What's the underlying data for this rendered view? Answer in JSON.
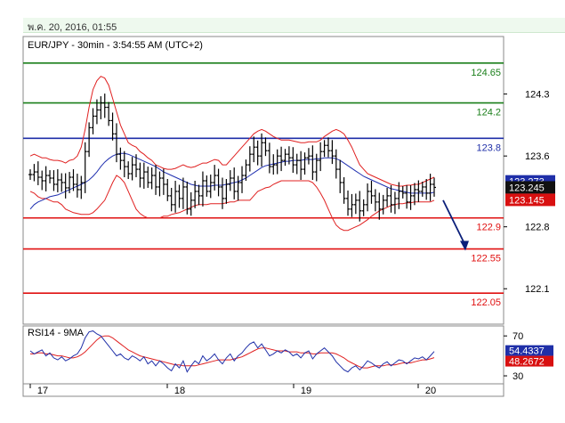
{
  "header": {
    "date_text": "พ.ค. 20, 2016, 01:55"
  },
  "chart_data": {
    "type": "candlestick",
    "title": "EUR/JPY - 30min - 3:54:55 AM (UTC+2)",
    "ylim": [
      121.7,
      124.95
    ],
    "y_ticks": [
      "124.3",
      "123.6",
      "122.8",
      "122.1"
    ],
    "x_ticks": [
      "17",
      "18",
      "19",
      "20"
    ],
    "levels": [
      {
        "value": 124.65,
        "label": "124.65",
        "color": "#1a7f1a"
      },
      {
        "value": 124.2,
        "label": "124.2",
        "color": "#1a7f1a"
      },
      {
        "value": 123.8,
        "label": "123.8",
        "color": "#1f2fa8"
      },
      {
        "value": 122.9,
        "label": "122.9",
        "color": "#e01010"
      },
      {
        "value": 122.55,
        "label": "122.55",
        "color": "#e01010"
      },
      {
        "value": 122.05,
        "label": "122.05",
        "color": "#e01010"
      }
    ],
    "price_tags": [
      {
        "value": 123.273,
        "label": "123.273",
        "bg": "#1f2fa8"
      },
      {
        "value": 123.245,
        "label": "123.245",
        "bg": "#111111"
      },
      {
        "value": 123.145,
        "label": "123.145",
        "bg": "#d81010"
      }
    ],
    "close": [
      123.39,
      123.42,
      123.36,
      123.32,
      123.38,
      123.35,
      123.28,
      123.33,
      123.3,
      123.24,
      123.36,
      123.28,
      123.22,
      123.3,
      123.65,
      123.92,
      124.05,
      124.12,
      124.2,
      124.15,
      124.0,
      123.85,
      123.62,
      123.55,
      123.48,
      123.4,
      123.5,
      123.45,
      123.35,
      123.42,
      123.3,
      123.38,
      123.25,
      123.35,
      123.28,
      123.15,
      123.05,
      123.2,
      123.12,
      123.25,
      123.0,
      123.1,
      123.2,
      123.15,
      123.32,
      123.2,
      123.3,
      123.38,
      123.25,
      123.12,
      123.28,
      123.35,
      123.2,
      123.3,
      123.38,
      123.5,
      123.62,
      123.7,
      123.6,
      123.75,
      123.66,
      123.48,
      123.5,
      123.6,
      123.55,
      123.62,
      123.58,
      123.5,
      123.55,
      123.45,
      123.58,
      123.6,
      123.42,
      123.55,
      123.65,
      123.72,
      123.66,
      123.6,
      123.45,
      123.3,
      123.12,
      123.0,
      123.05,
      123.1,
      122.98,
      123.05,
      123.2,
      123.15,
      123.08,
      123.0,
      123.1,
      123.15,
      123.05,
      123.12,
      123.2,
      123.18,
      123.08,
      123.15,
      123.22,
      123.2,
      123.25,
      123.18,
      123.28,
      123.245
    ],
    "ma_ref": [
      123.0,
      123.05,
      123.08,
      123.1,
      123.12,
      123.14,
      123.15,
      123.16,
      123.18,
      123.2,
      123.22,
      123.24,
      123.26,
      123.28,
      123.3,
      123.33,
      123.37,
      123.42,
      123.48,
      123.53,
      123.57,
      123.6,
      123.62,
      123.63,
      123.63,
      123.62,
      123.6,
      123.58,
      123.56,
      123.54,
      123.52,
      123.5,
      123.48,
      123.45,
      123.42,
      123.4,
      123.38,
      123.36,
      123.34,
      123.32,
      123.3,
      123.28,
      123.27,
      123.26,
      123.26,
      123.26,
      123.26,
      123.27,
      123.27,
      123.27,
      123.28,
      123.29,
      123.3,
      123.31,
      123.33,
      123.35,
      123.38,
      123.41,
      123.44,
      123.47,
      123.49,
      123.5,
      123.51,
      123.52,
      123.53,
      123.54,
      123.54,
      123.55,
      123.55,
      123.55,
      123.56,
      123.56,
      123.56,
      123.57,
      123.57,
      123.58,
      123.58,
      123.58,
      123.57,
      123.55,
      123.52,
      123.49,
      123.46,
      123.43,
      123.4,
      123.37,
      123.35,
      123.33,
      123.31,
      123.29,
      123.27,
      123.25,
      123.23,
      123.22,
      123.21,
      123.2,
      123.19,
      123.18,
      123.18,
      123.18,
      123.18,
      123.18,
      123.18,
      123.19
    ],
    "upper_band": [
      123.6,
      123.62,
      123.6,
      123.58,
      123.58,
      123.56,
      123.55,
      123.55,
      123.54,
      123.52,
      123.55,
      123.56,
      123.6,
      123.7,
      123.9,
      124.15,
      124.35,
      124.45,
      124.5,
      124.48,
      124.4,
      124.25,
      124.1,
      123.95,
      123.85,
      123.75,
      123.72,
      123.7,
      123.65,
      123.62,
      123.58,
      123.55,
      123.5,
      123.48,
      123.46,
      123.45,
      123.45,
      123.46,
      123.48,
      123.5,
      123.48,
      123.47,
      123.48,
      123.5,
      123.52,
      123.52,
      123.54,
      123.56,
      123.55,
      123.5,
      123.5,
      123.55,
      123.6,
      123.65,
      123.7,
      123.75,
      123.8,
      123.85,
      123.88,
      123.9,
      123.88,
      123.85,
      123.82,
      123.8,
      123.78,
      123.78,
      123.78,
      123.77,
      123.76,
      123.75,
      123.75,
      123.76,
      123.76,
      123.76,
      123.78,
      123.82,
      123.85,
      123.88,
      123.9,
      123.88,
      123.85,
      123.78,
      123.7,
      123.6,
      123.5,
      123.45,
      123.4,
      123.38,
      123.36,
      123.34,
      123.32,
      123.3,
      123.28,
      123.27,
      123.26,
      123.26,
      123.27,
      123.27,
      123.28,
      123.28,
      123.3,
      123.32,
      123.34,
      123.36
    ],
    "lower_band": [
      123.2,
      123.18,
      123.14,
      123.12,
      123.12,
      123.1,
      123.08,
      123.08,
      123.05,
      123.0,
      122.98,
      122.96,
      122.95,
      122.94,
      122.94,
      122.94,
      122.96,
      123.0,
      123.05,
      123.1,
      123.2,
      123.3,
      123.38,
      123.35,
      123.3,
      123.2,
      123.1,
      123.0,
      122.95,
      122.92,
      122.9,
      122.9,
      122.9,
      122.9,
      122.92,
      122.92,
      122.94,
      122.95,
      122.96,
      122.98,
      123.0,
      123.02,
      123.04,
      123.05,
      123.05,
      123.05,
      123.06,
      123.06,
      123.06,
      123.06,
      123.07,
      123.08,
      123.08,
      123.1,
      123.1,
      123.1,
      123.1,
      123.15,
      123.2,
      123.22,
      123.24,
      123.25,
      123.28,
      123.3,
      123.32,
      123.32,
      123.32,
      123.32,
      123.32,
      123.32,
      123.32,
      123.32,
      123.3,
      123.25,
      123.18,
      123.1,
      123.0,
      122.9,
      122.82,
      122.78,
      122.76,
      122.76,
      122.78,
      122.8,
      122.82,
      122.85,
      122.88,
      122.92,
      122.95,
      122.98,
      123.0,
      123.02,
      123.04,
      123.05,
      123.06,
      123.06,
      123.07,
      123.07,
      123.08,
      123.08,
      123.08,
      123.08,
      123.08,
      123.1
    ],
    "projection": [
      123.1,
      122.55
    ],
    "rsi": {
      "label": "RSI14 - 9MA",
      "ylim": [
        22,
        80
      ],
      "y_ticks": [
        "70",
        "30"
      ],
      "rsi_tag": {
        "value": 54.4337,
        "label": "54.4337",
        "bg": "#1f2fa8"
      },
      "ma_tag": {
        "value": 48.2672,
        "label": "48.2672",
        "bg": "#d81010"
      },
      "rsi_values": [
        55,
        52,
        54,
        56,
        50,
        53,
        48,
        46,
        49,
        45,
        47,
        50,
        52,
        58,
        68,
        74,
        75,
        72,
        70,
        65,
        60,
        55,
        50,
        52,
        48,
        46,
        50,
        48,
        45,
        49,
        42,
        45,
        40,
        45,
        42,
        38,
        35,
        42,
        38,
        45,
        34,
        40,
        45,
        42,
        50,
        45,
        48,
        52,
        46,
        42,
        48,
        52,
        45,
        50,
        53,
        58,
        62,
        64,
        58,
        62,
        56,
        50,
        52,
        55,
        53,
        56,
        54,
        50,
        52,
        48,
        53,
        55,
        47,
        52,
        55,
        58,
        54,
        50,
        44,
        40,
        36,
        34,
        38,
        40,
        36,
        40,
        45,
        43,
        40,
        38,
        42,
        44,
        40,
        43,
        46,
        45,
        42,
        45,
        48,
        47,
        49,
        46,
        50,
        54.4337
      ],
      "ma_values": [
        52,
        52,
        53,
        53,
        52,
        52,
        51,
        50,
        50,
        49,
        48,
        48,
        49,
        51,
        54,
        58,
        62,
        66,
        69,
        70,
        70,
        68,
        65,
        62,
        59,
        56,
        54,
        52,
        50,
        49,
        48,
        47,
        46,
        45,
        44,
        43,
        42,
        41,
        41,
        40,
        40,
        40,
        40,
        41,
        42,
        43,
        44,
        45,
        46,
        46,
        46,
        46,
        47,
        48,
        49,
        51,
        53,
        55,
        57,
        58,
        58,
        57,
        56,
        55,
        55,
        55,
        54,
        54,
        54,
        53,
        53,
        53,
        52,
        52,
        53,
        53,
        53,
        53,
        52,
        50,
        48,
        45,
        43,
        41,
        39,
        38,
        38,
        39,
        40,
        40,
        40,
        41,
        41,
        41,
        42,
        43,
        43,
        43,
        44,
        45,
        46,
        46,
        47,
        48.2672
      ]
    }
  }
}
